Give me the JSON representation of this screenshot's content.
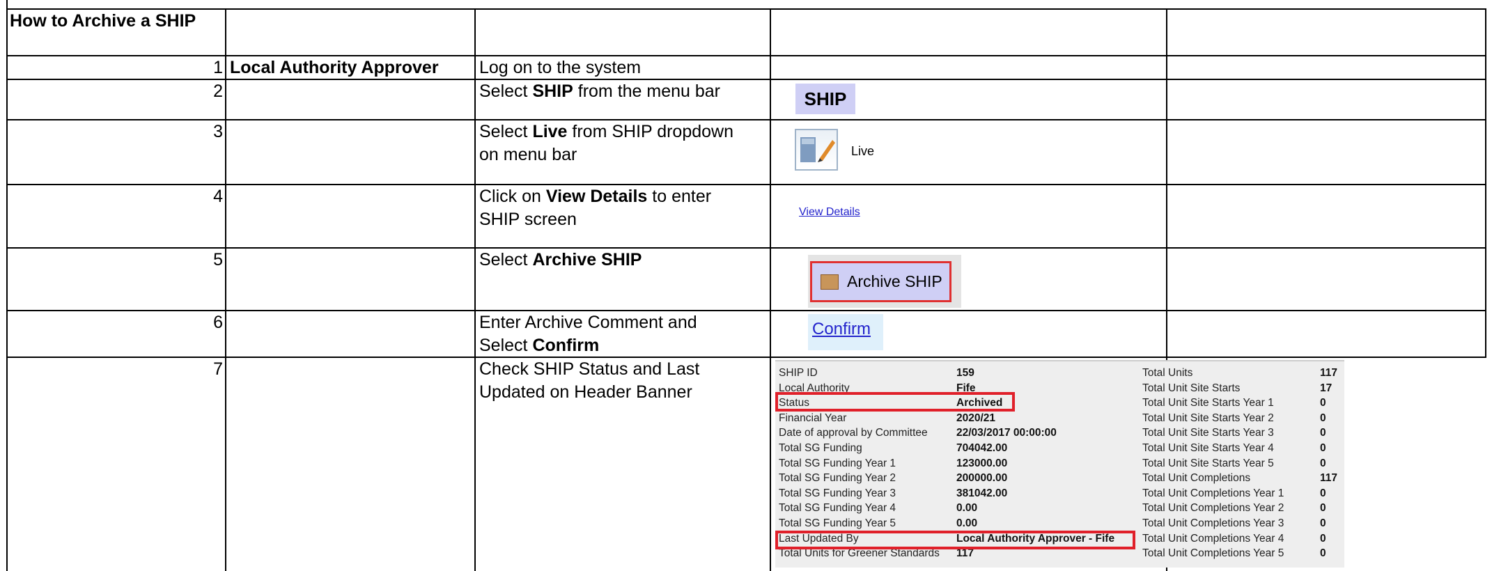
{
  "title": "How to Archive a SHIP",
  "steps": [
    {
      "num": "1",
      "role": "Local Authority Approver",
      "desc_plain": "Log on to the system"
    },
    {
      "num": "2",
      "desc_pre": "Select ",
      "desc_bold": "SHIP",
      "desc_post": " from the menu bar"
    },
    {
      "num": "3",
      "desc_pre": "Select ",
      "desc_bold": "Live",
      "desc_post": " from SHIP dropdown",
      "desc_line2": "on menu bar"
    },
    {
      "num": "4",
      "desc_pre": "Click on ",
      "desc_bold": "View Details",
      "desc_post": " to enter",
      "desc_line2": "SHIP screen"
    },
    {
      "num": "5",
      "desc_pre": "Select ",
      "desc_bold": "Archive SHIP"
    },
    {
      "num": "6",
      "desc_line1": "Enter Archive Comment and",
      "desc_pre2": "Select ",
      "desc_bold2": "Confirm"
    },
    {
      "num": "7",
      "desc_line1": "Check SHIP Status and Last",
      "desc_line2": "Updated on Header Banner"
    }
  ],
  "screens": {
    "ship_menu": "SHIP",
    "live_label": "Live",
    "view_details_link": "View Details",
    "archive_button": "Archive SHIP",
    "confirm_link": "Confirm"
  },
  "banner": {
    "left": [
      {
        "label": "SHIP ID",
        "value": "159"
      },
      {
        "label": "Local Authority",
        "value": "Fife"
      },
      {
        "label": "Status",
        "value": "Archived"
      },
      {
        "label": "Financial Year",
        "value": "2020/21"
      },
      {
        "label": "Date of approval by Committee",
        "value": "22/03/2017 00:00:00"
      },
      {
        "label": "Total SG Funding",
        "value": "704042.00"
      },
      {
        "label": "Total SG Funding Year 1",
        "value": "123000.00"
      },
      {
        "label": "Total SG Funding Year 2",
        "value": "200000.00"
      },
      {
        "label": "Total SG Funding Year 3",
        "value": "381042.00"
      },
      {
        "label": "Total SG Funding Year 4",
        "value": "0.00"
      },
      {
        "label": "Total SG Funding Year 5",
        "value": "0.00"
      },
      {
        "label": "Last Updated By",
        "value": "Local Authority Approver - Fife"
      },
      {
        "label": "Total Units for Greener Standards",
        "value": "117"
      }
    ],
    "right": [
      {
        "label": "Total Units",
        "value": "117"
      },
      {
        "label": "Total Unit Site Starts",
        "value": "17"
      },
      {
        "label": "Total Unit Site Starts Year 1",
        "value": "0"
      },
      {
        "label": "Total Unit Site Starts Year 2",
        "value": "0"
      },
      {
        "label": "Total Unit Site Starts Year 3",
        "value": "0"
      },
      {
        "label": "Total Unit Site Starts Year 4",
        "value": "0"
      },
      {
        "label": "Total Unit Site Starts Year 5",
        "value": "0"
      },
      {
        "label": "Total Unit Completions",
        "value": "117"
      },
      {
        "label": "Total Unit Completions Year 1",
        "value": "0"
      },
      {
        "label": "Total Unit Completions Year 2",
        "value": "0"
      },
      {
        "label": "Total Unit Completions Year 3",
        "value": "0"
      },
      {
        "label": "Total Unit Completions Year 4",
        "value": "0"
      },
      {
        "label": "Total Unit Completions Year 5",
        "value": "0"
      }
    ]
  },
  "colors": {
    "highlight": "#e0202a",
    "chip": "#cfcff5",
    "link": "#2222cc"
  }
}
